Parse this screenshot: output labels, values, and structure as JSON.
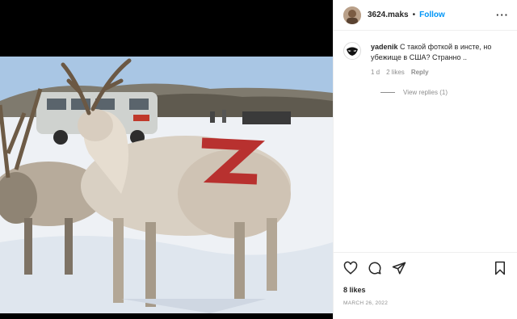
{
  "post": {
    "username": "3624.maks",
    "separator": "•",
    "follow_label": "Follow",
    "more_label": "···"
  },
  "comment": {
    "username": "yadenik",
    "text": "С такой фоткой в инсте, но убежище в США? Странно ..",
    "time": "1 d",
    "likes": "2 likes",
    "reply_label": "Reply",
    "view_replies_label": "View replies (1)"
  },
  "footer": {
    "likes": "8 likes",
    "date": "MARCH 26, 2022"
  },
  "image": {
    "painted_symbol": "Z"
  },
  "icons": [
    "heart-icon",
    "comment-icon",
    "share-icon",
    "bookmark-icon",
    "more-icon"
  ],
  "colors": {
    "follow": "#0095f6",
    "meta_text": "#8e8e8e",
    "symbol_red": "#b8312f"
  }
}
